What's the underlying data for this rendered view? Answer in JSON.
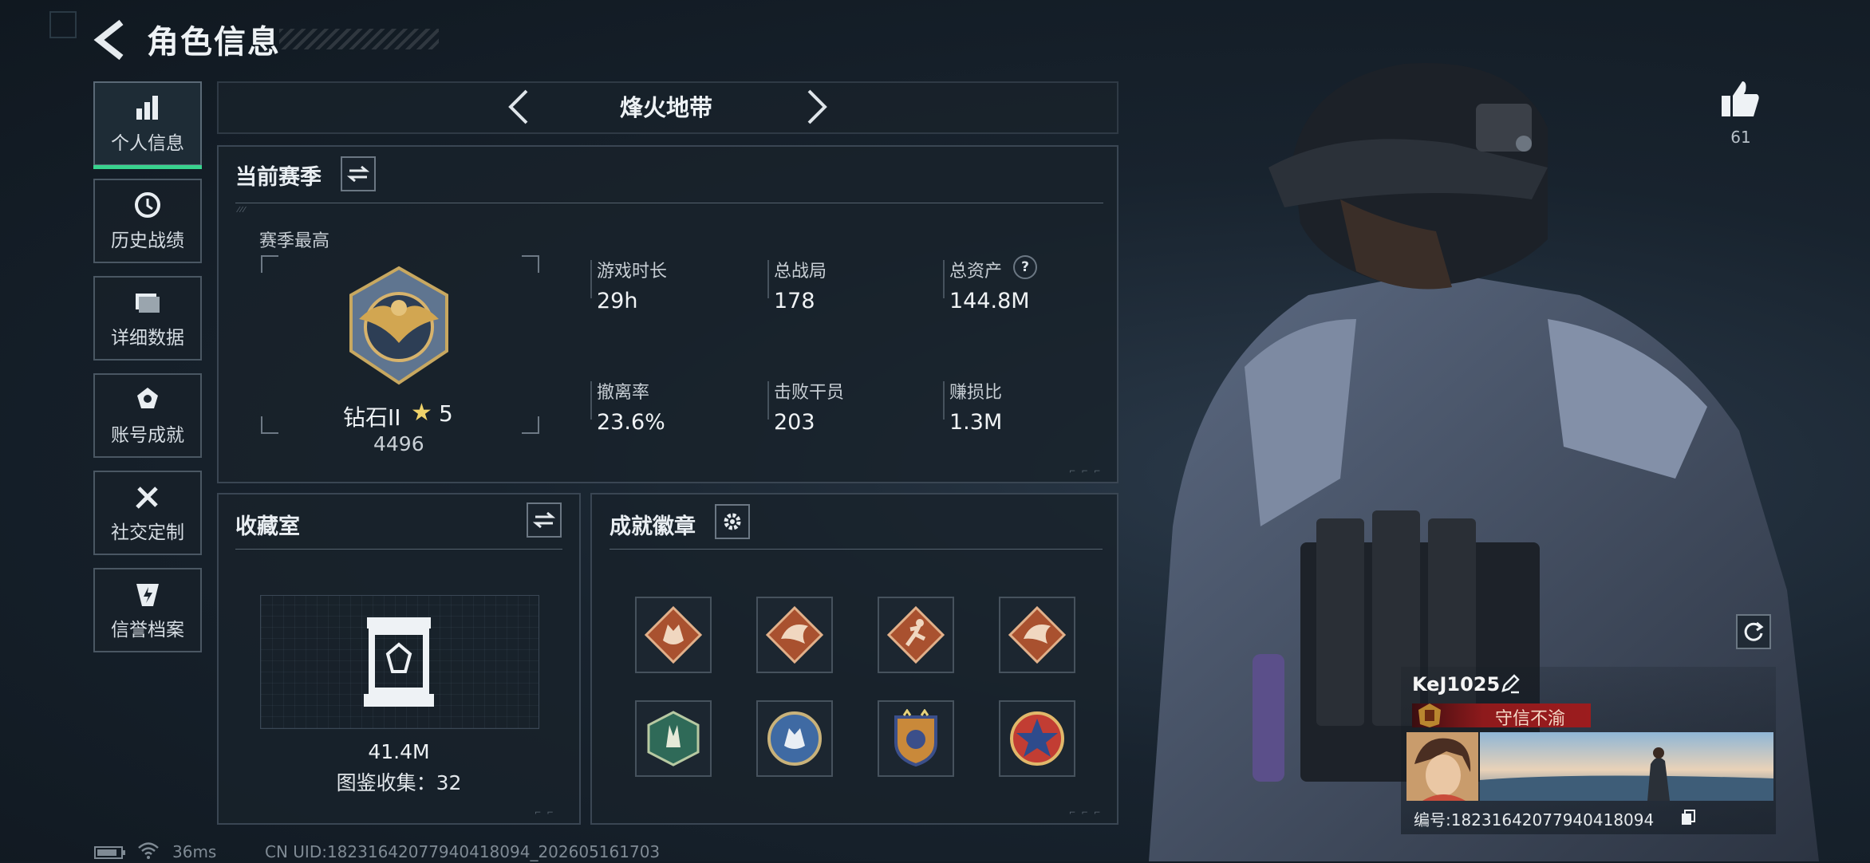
{
  "header": {
    "title": "角色信息"
  },
  "sidebar": {
    "items": [
      {
        "label": "个人信息",
        "icon": "bar-chart-icon",
        "active": true
      },
      {
        "label": "历史战绩",
        "icon": "history-clock-icon"
      },
      {
        "label": "详细数据",
        "icon": "folder-icon"
      },
      {
        "label": "账号成就",
        "icon": "medal-icon"
      },
      {
        "label": "社交定制",
        "icon": "wrench-icon"
      },
      {
        "label": "信誉档案",
        "icon": "shield-bolt-icon"
      }
    ]
  },
  "mode_selector": {
    "label": "烽火地带"
  },
  "season": {
    "title": "当前赛季",
    "best_label": "赛季最高",
    "rank": {
      "name": "钻石II",
      "stars": "5",
      "score": "4496"
    },
    "stats": [
      {
        "label": "游戏时长",
        "value": "29h"
      },
      {
        "label": "总战局",
        "value": "178"
      },
      {
        "label": "总资产",
        "value": "144.8M"
      },
      {
        "label": "撤离率",
        "value": "23.6%"
      },
      {
        "label": "击败干员",
        "value": "203"
      },
      {
        "label": "赚损比",
        "value": "1.3M"
      }
    ],
    "help_glyph": "?"
  },
  "collection": {
    "title": "收藏室",
    "value": "41.4M",
    "count_text": "图鉴收集：32"
  },
  "achievements": {
    "title": "成就徽章",
    "badges": [
      {
        "icon": "wolf-badge-icon",
        "color": "#b8562e"
      },
      {
        "icon": "dragon-badge-icon",
        "color": "#b8562e"
      },
      {
        "icon": "runner-badge-icon",
        "color": "#b8562e"
      },
      {
        "icon": "dragon-badge-icon",
        "color": "#b8562e"
      },
      {
        "icon": "rabbit-badge-icon",
        "color": "#2f6a58"
      },
      {
        "icon": "wolf-blue-badge-icon",
        "color": "#3f6aa3"
      },
      {
        "icon": "star-shield-badge-icon",
        "color": "#c9893a"
      },
      {
        "icon": "star-emblem-badge-icon",
        "color": "#c23d33"
      }
    ]
  },
  "likes": {
    "count": "61"
  },
  "player_card": {
    "name": "KeJ1025",
    "title": "守信不渝",
    "id_text": "编号:18231642077940418094"
  },
  "status_bar": {
    "ping": "36ms",
    "uid": "CN UID:18231642077940418094_202605161703"
  },
  "colors": {
    "accent": "#38d38e",
    "title_red": "#9c1c1e"
  }
}
